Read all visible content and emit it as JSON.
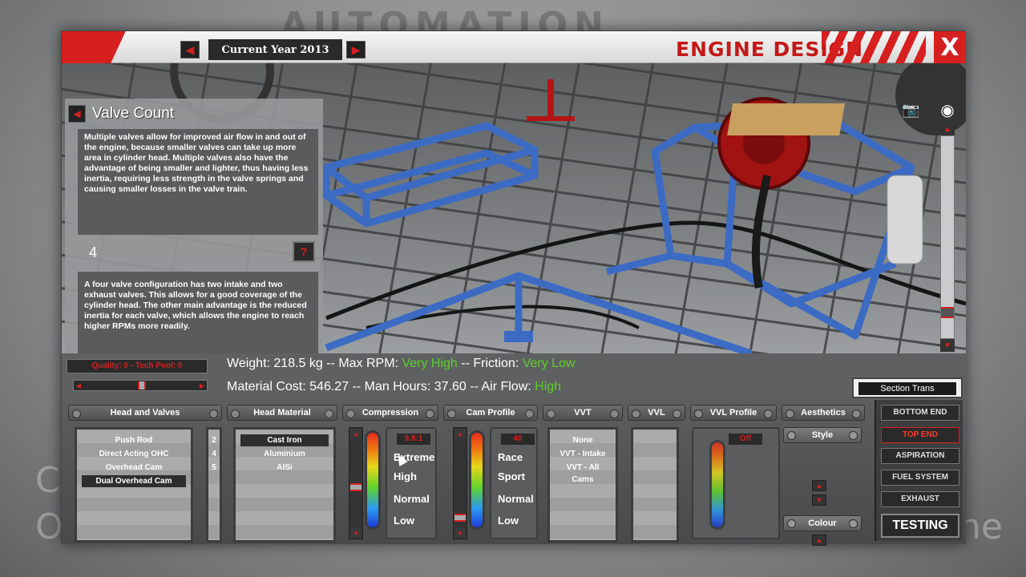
{
  "background": {
    "logo_text": "AUTOMATION",
    "ghost_left_1": "C",
    "ghost_left_2": "O",
    "ghost_right": "ne"
  },
  "titlebar": {
    "year_prev_icon": "left-arrow-icon",
    "year_label": "Current Year 2013",
    "year_next_icon": "right-arrow-icon",
    "title": "ENGINE DESIGN",
    "close_label": "X"
  },
  "info_panel": {
    "back_icon": "left-arrow-icon",
    "title": "Valve Count",
    "description": "Multiple valves allow for improved air flow in and out of the engine, because smaller valves can take up more area in cylinder head. Multiple valves also have the advantage of being smaller and lighter, thus having less inertia, requiring less strength in the valve springs and causing smaller losses in the valve train.",
    "value": "4",
    "help_label": "?",
    "detail": "A four valve configuration has two intake and two exhaust valves. This allows for a good coverage of the cylinder head. The other main advantage is the reduced inertia for each valve, which allows the engine to reach higher RPMs more readily."
  },
  "view_controls": {
    "camera_icon": "camera-icon",
    "eye_icon": "eye-icon",
    "nav_icon": "navigate-icon"
  },
  "stats": {
    "quality_label": "Quality: 0 - Tech Pool: 0",
    "weight_label": "Weight: 218.5 kg -- Max RPM: ",
    "max_rpm_value": "Very High",
    "friction_label": " -- Friction: ",
    "friction_value": "Very Low",
    "cost_label": "Material Cost: 546.27 -- Man Hours: 37.60 -- Air Flow: ",
    "airflow_value": "High",
    "selector_label": "Section Trans"
  },
  "columns": {
    "head_and_valves": {
      "header": "Head and Valves",
      "options": [
        "Push Rod",
        "Direct Acting OHC",
        "Overhead Cam",
        "Dual Overhead Cam"
      ],
      "selected": "Dual Overhead Cam",
      "counts": [
        "2",
        "4",
        "5"
      ]
    },
    "head_material": {
      "header": "Head Material",
      "options": [
        "Cast Iron",
        "Aluminium",
        "AlSi"
      ],
      "selected": "Cast Iron"
    },
    "compression": {
      "header": "Compression",
      "readout": "9.8:1",
      "levels": [
        "Extreme",
        "High",
        "Normal",
        "Low"
      ]
    },
    "cam_profile": {
      "header": "Cam Profile",
      "readout": "40",
      "levels": [
        "Race",
        "Sport",
        "Normal",
        "Low"
      ]
    },
    "vvt": {
      "header": "VVT",
      "options": [
        "None",
        "VVT - Intake",
        "VVT - All Cams"
      ]
    },
    "vvl": {
      "header": "VVL"
    },
    "vvl_profile": {
      "header": "VVL Profile",
      "readout": "Off"
    },
    "aesthetics": {
      "header": "Aesthetics",
      "style_label": "Style",
      "colour_label": "Colour"
    }
  },
  "side_nav": {
    "items": [
      "BOTTOM END",
      "TOP END",
      "ASPIRATION",
      "FUEL SYSTEM",
      "EXHAUST"
    ],
    "active": "TOP END",
    "testing_label": "TESTING"
  },
  "colors": {
    "accent_red": "#d62020",
    "highlight_green": "#5ccf2a"
  }
}
